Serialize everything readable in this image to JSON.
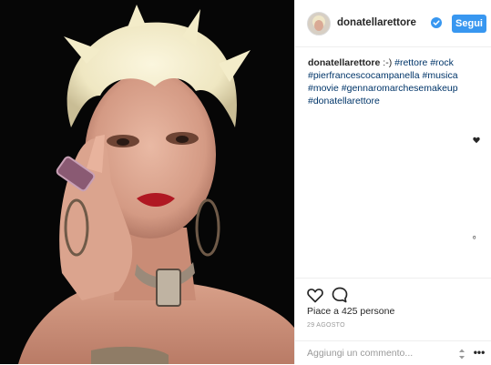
{
  "header": {
    "username": "donatellarettore",
    "follow_label": "Segui",
    "verified_icon": "verified-badge-icon"
  },
  "caption": {
    "username": "donatellarettore",
    "text": ":-) ",
    "hashtags": [
      "#rettore",
      "#rock",
      "#pierfrancescocampanella",
      "#musica",
      "#movie",
      "#gennaromarchesemakeup",
      "#donatellarettore"
    ]
  },
  "actions": {
    "like_icon": "heart-icon",
    "comment_icon": "comment-icon",
    "likes_text": "Piace a 425 persone",
    "date": "29 AGOSTO"
  },
  "comment": {
    "placeholder": "Aggiungi un commento...",
    "more_icon": "more-options-icon",
    "more_label": "•••"
  },
  "colors": {
    "follow_button": "#3897f0",
    "hashtag": "#003569",
    "photo_background": "#060606"
  }
}
